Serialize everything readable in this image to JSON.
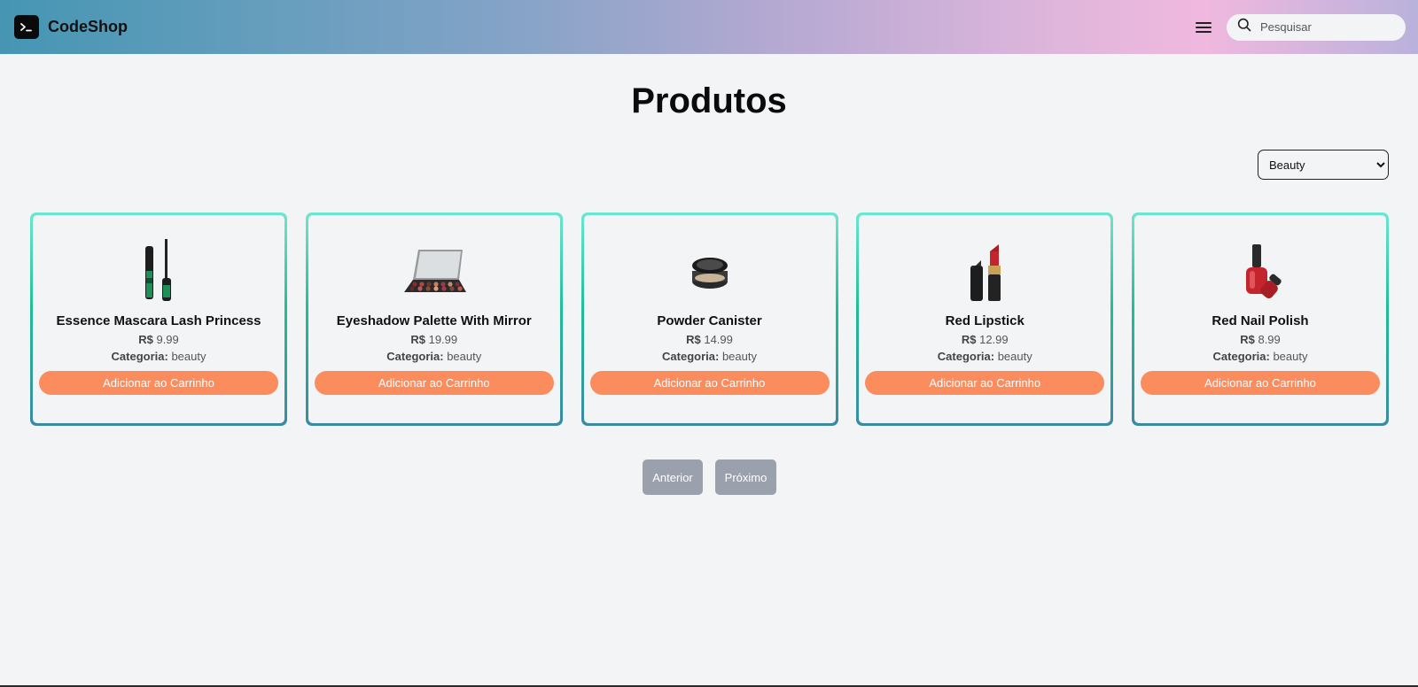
{
  "header": {
    "brand": "CodeShop"
  },
  "search": {
    "placeholder": "Pesquisar"
  },
  "main": {
    "title": "Produtos"
  },
  "filter": {
    "selected": "Beauty"
  },
  "products": [
    {
      "title": "Essence Mascara Lash Princess",
      "currency": "R$",
      "price": "9.99",
      "category_label": "Categoria:",
      "category": "beauty",
      "button": "Adicionar ao Carrinho",
      "image": "mascara-image"
    },
    {
      "title": "Eyeshadow Palette With Mirror",
      "currency": "R$",
      "price": "19.99",
      "category_label": "Categoria:",
      "category": "beauty",
      "button": "Adicionar ao Carrinho",
      "image": "eyeshadow-palette-image"
    },
    {
      "title": "Powder Canister",
      "currency": "R$",
      "price": "14.99",
      "category_label": "Categoria:",
      "category": "beauty",
      "button": "Adicionar ao Carrinho",
      "image": "powder-canister-image"
    },
    {
      "title": "Red Lipstick",
      "currency": "R$",
      "price": "12.99",
      "category_label": "Categoria:",
      "category": "beauty",
      "button": "Adicionar ao Carrinho",
      "image": "lipstick-image"
    },
    {
      "title": "Red Nail Polish",
      "currency": "R$",
      "price": "8.99",
      "category_label": "Categoria:",
      "category": "beauty",
      "button": "Adicionar ao Carrinho",
      "image": "nail-polish-image"
    }
  ],
  "pagination": {
    "prev": "Anterior",
    "next": "Próximo"
  },
  "colors": {
    "accent": "#fb8c5e",
    "card_border_top": "#6de6cf",
    "card_border_bottom": "#3a8aa3",
    "pager": "#9aa1ad"
  },
  "icons": [
    "terminal-icon",
    "menu-icon",
    "search-icon"
  ]
}
